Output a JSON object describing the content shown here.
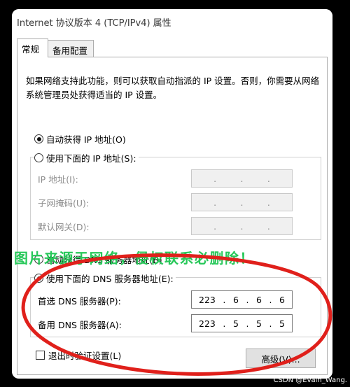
{
  "window": {
    "title": "Internet 协议版本 4 (TCP/IPv4) 属性"
  },
  "tabs": [
    {
      "label": "常规",
      "active": true
    },
    {
      "label": "备用配置",
      "active": false
    }
  ],
  "description": "如果网络支持此功能，则可以获取自动指派的 IP 设置。否则，你需要从网络系统管理员处获得适当的 IP 设置。",
  "ip": {
    "auto_label": "自动获得 IP 地址(O)",
    "auto_selected": true,
    "manual_label": "使用下面的 IP 地址(S):",
    "fields": [
      {
        "label": "IP 地址(I):"
      },
      {
        "label": "子网掩码(U):"
      },
      {
        "label": "默认网关(D):"
      }
    ]
  },
  "dns": {
    "auto_label": "自动获得 DNS 服务器地址(B)",
    "manual_label": "使用下面的 DNS 服务器地址(E):",
    "manual_selected": true,
    "preferred_label": "首选 DNS 服务器(P):",
    "preferred_octets": [
      "223",
      "6",
      "6",
      "6"
    ],
    "alternate_label": "备用 DNS 服务器(A):",
    "alternate_octets": [
      "223",
      "5",
      "5",
      "5"
    ]
  },
  "validate_label": "退出时验证设置(L)",
  "advanced_label": "高级(V)...",
  "overlay": {
    "watermark": "图片来源于网络，侵权联系必删除！",
    "credit": "CSDN @Evain_Wang.",
    "annotation_color": "#e0201b",
    "watermark_color": "#28c85a"
  }
}
